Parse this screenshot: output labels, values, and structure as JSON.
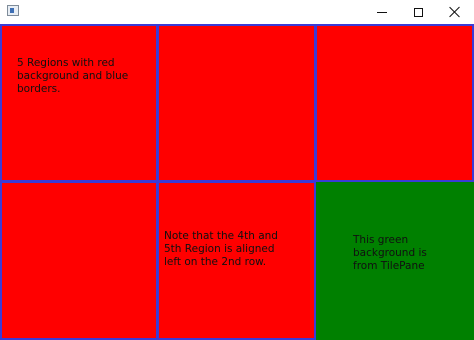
{
  "window": {
    "icon": "java-app-icon",
    "controls": {
      "minimize": "minimize-icon",
      "maximize": "maximize-icon",
      "close": "close-icon"
    }
  },
  "tilepane": {
    "background_color": "#008000",
    "region_color": "#ff0000",
    "border_color": "#3b3bd6",
    "regions": [
      {
        "text": "5 Regions with red\nbackground and blue\nborders."
      },
      {
        "text": ""
      },
      {
        "text": ""
      },
      {
        "text": ""
      },
      {
        "text": "Note that the 4th and\n5th Region is aligned\nleft on the 2nd row."
      }
    ],
    "green_note": "This green\nbackground is\nfrom TilePane"
  }
}
